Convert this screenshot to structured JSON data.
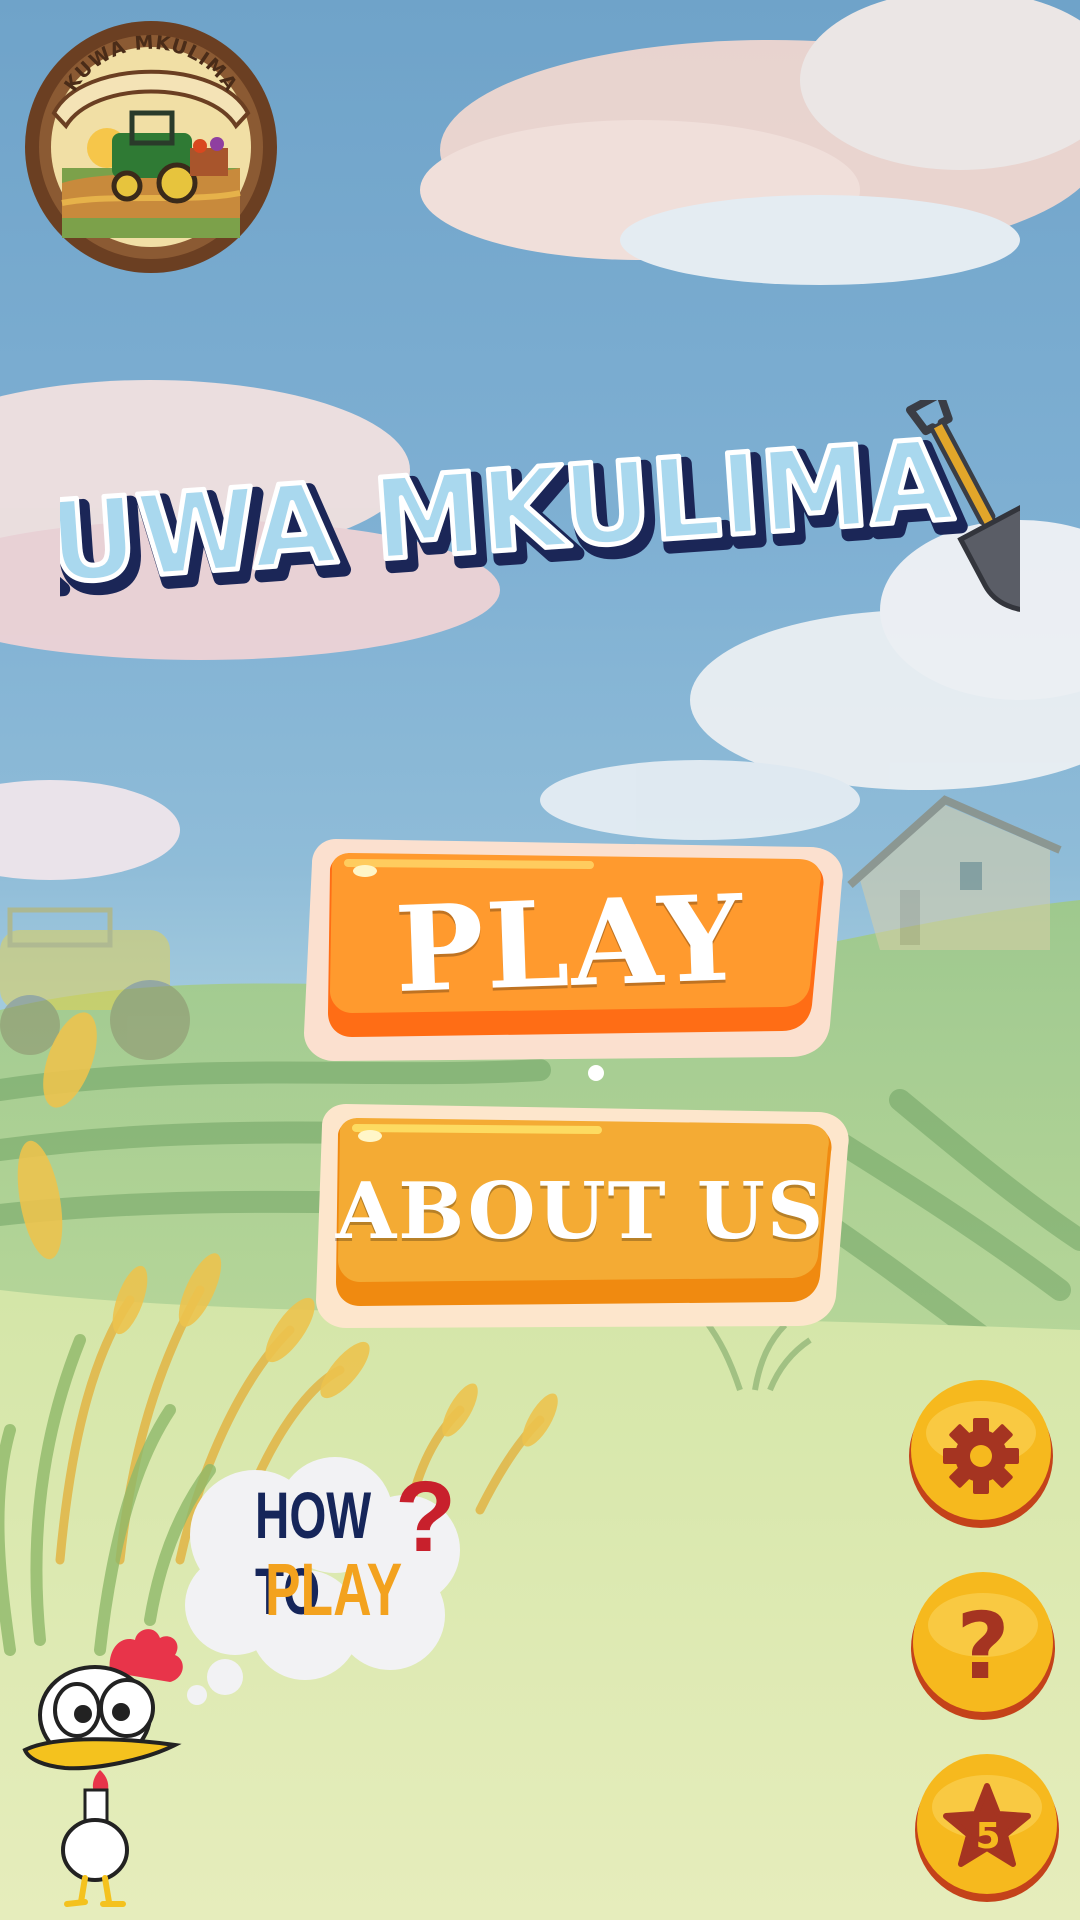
{
  "logo": {
    "text": "KUWA MKULIMA"
  },
  "title": {
    "text": "KUWA MKULIMA"
  },
  "menu": {
    "play_label": "PLAY",
    "about_label": "ABOUT US"
  },
  "how_to_play": {
    "line1": "HOW TO",
    "line2": "PLAY",
    "mark": "?"
  },
  "side_buttons": {
    "help_glyph": "?",
    "level_number": "5"
  },
  "colors": {
    "button_orange": "#ff8a1e",
    "button_amber": "#f3a21e",
    "title_fill": "#a9d8ee",
    "title_outline": "#1b2657",
    "round_button": "#f6b91e",
    "round_icon": "#a53421"
  },
  "icons": [
    "gear-icon",
    "question-icon",
    "star-icon",
    "shovel-icon",
    "chicken-mascot"
  ]
}
